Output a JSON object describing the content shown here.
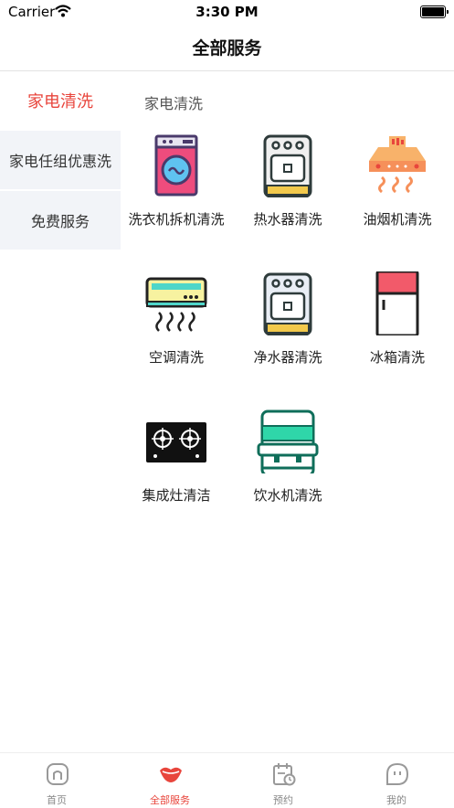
{
  "status_bar": {
    "carrier": "Carrier",
    "time": "3:30 PM"
  },
  "nav": {
    "title": "全部服务"
  },
  "sidebar": {
    "items": [
      {
        "label": "家电清洗",
        "active": true
      },
      {
        "label": "家电任组优惠洗",
        "active": false
      },
      {
        "label": "免费服务",
        "active": false
      }
    ]
  },
  "section": {
    "title": "家电清洗"
  },
  "services": [
    {
      "label": "洗衣机拆机清洗",
      "icon": "washing-machine-icon"
    },
    {
      "label": "热水器清洗",
      "icon": "water-heater-icon"
    },
    {
      "label": "油烟机清洗",
      "icon": "range-hood-icon"
    },
    {
      "label": "空调清洗",
      "icon": "air-conditioner-icon"
    },
    {
      "label": "净水器清洗",
      "icon": "water-purifier-icon"
    },
    {
      "label": "冰箱清洗",
      "icon": "refrigerator-icon"
    },
    {
      "label": "集成灶清洁",
      "icon": "gas-stove-icon"
    },
    {
      "label": "饮水机清洗",
      "icon": "water-dispenser-icon"
    }
  ],
  "tab_bar": {
    "items": [
      {
        "label": "首页",
        "icon": "home-icon",
        "active": false
      },
      {
        "label": "全部服务",
        "icon": "lips-icon",
        "active": true
      },
      {
        "label": "预约",
        "icon": "calendar-clock-icon",
        "active": false
      },
      {
        "label": "我的",
        "icon": "profile-icon",
        "active": false
      }
    ]
  },
  "colors": {
    "accent": "#e8453c",
    "sidebar_bg": "#f2f4f8"
  }
}
